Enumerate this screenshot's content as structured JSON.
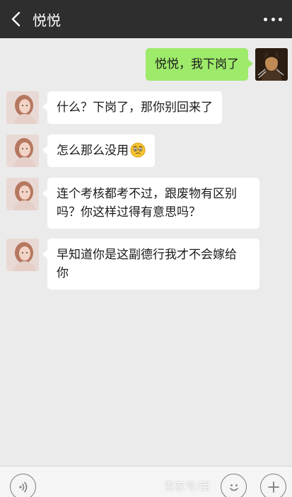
{
  "header": {
    "title": "悦悦",
    "back_icon": "chevron-left-icon",
    "more_icon": "more-dots-icon"
  },
  "messages": [
    {
      "sender": "me",
      "text": "悦悦，我下岗了"
    },
    {
      "sender": "contact",
      "text": "什么？下岗了，那你别回来了"
    },
    {
      "sender": "contact",
      "text": "怎么那么没用",
      "emoji": "worried-face-icon"
    },
    {
      "sender": "contact",
      "line1": "连个考核都考不过，跟废物有区别",
      "line2": "吗？你这样过得有意思吗？"
    },
    {
      "sender": "contact",
      "line1": "早知道你是这副德行我才不会嫁给",
      "line2": "你"
    }
  ],
  "input_bar": {
    "voice_icon": "voice-icon",
    "emoji_icon": "emoji-icon",
    "plus_icon": "plus-icon"
  },
  "watermark": "百家号/西",
  "colors": {
    "header_bg": "#2e2e2e",
    "chat_bg": "#ebebeb",
    "my_bubble": "#9eea6a",
    "their_bubble": "#ffffff"
  }
}
